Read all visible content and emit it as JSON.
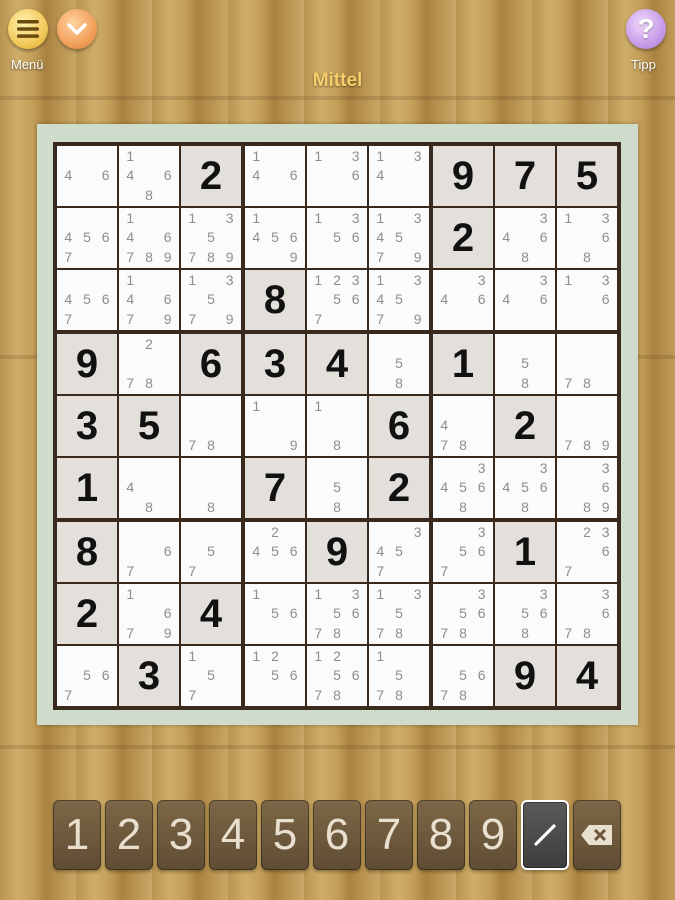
{
  "header": {
    "menu_label": "Menü",
    "tip_label": "Tipp",
    "difficulty": "Mittel",
    "icons": {
      "menu": "hamburger-icon",
      "collapse": "chevron-down-icon",
      "tip": "question-icon"
    }
  },
  "board": {
    "cells": [
      [
        {
          "n": [
            4,
            6
          ]
        },
        {
          "n": [
            1,
            4,
            6,
            8
          ]
        },
        {
          "v": 2
        },
        {
          "n": [
            1,
            4,
            6
          ]
        },
        {
          "n": [
            1,
            3,
            6
          ]
        },
        {
          "n": [
            1,
            3,
            4
          ]
        },
        {
          "v": 9
        },
        {
          "v": 7
        },
        {
          "v": 5
        }
      ],
      [
        {
          "n": [
            4,
            5,
            6,
            7
          ]
        },
        {
          "n": [
            1,
            4,
            6,
            7,
            8,
            9
          ]
        },
        {
          "n": [
            1,
            3,
            5,
            7,
            8,
            9
          ]
        },
        {
          "n": [
            1,
            4,
            5,
            6,
            9
          ]
        },
        {
          "n": [
            1,
            3,
            5,
            6
          ]
        },
        {
          "n": [
            1,
            3,
            4,
            5,
            7,
            9
          ]
        },
        {
          "v": 2
        },
        {
          "n": [
            3,
            4,
            6,
            8
          ]
        },
        {
          "n": [
            1,
            3,
            6,
            8
          ]
        }
      ],
      [
        {
          "n": [
            4,
            5,
            6,
            7
          ]
        },
        {
          "n": [
            1,
            4,
            6,
            7,
            9
          ]
        },
        {
          "n": [
            1,
            3,
            5,
            7,
            9
          ]
        },
        {
          "v": 8
        },
        {
          "n": [
            1,
            2,
            3,
            5,
            6,
            7
          ]
        },
        {
          "n": [
            1,
            3,
            4,
            5,
            7,
            9
          ]
        },
        {
          "n": [
            3,
            4,
            6
          ]
        },
        {
          "n": [
            3,
            4,
            6
          ]
        },
        {
          "n": [
            1,
            3,
            6
          ]
        }
      ],
      [
        {
          "v": 9
        },
        {
          "n": [
            2,
            7,
            8
          ]
        },
        {
          "v": 6
        },
        {
          "v": 3
        },
        {
          "v": 4
        },
        {
          "n": [
            5,
            8
          ]
        },
        {
          "v": 1
        },
        {
          "n": [
            5,
            8
          ]
        },
        {
          "n": [
            7,
            8
          ]
        }
      ],
      [
        {
          "v": 3
        },
        {
          "v": 5
        },
        {
          "n": [
            7,
            8
          ]
        },
        {
          "n": [
            1,
            9
          ]
        },
        {
          "n": [
            1,
            8
          ]
        },
        {
          "v": 6
        },
        {
          "n": [
            4,
            7,
            8
          ]
        },
        {
          "v": 2
        },
        {
          "n": [
            7,
            8,
            9
          ]
        }
      ],
      [
        {
          "v": 1
        },
        {
          "n": [
            4,
            8
          ]
        },
        {
          "n": [
            8
          ]
        },
        {
          "v": 7
        },
        {
          "n": [
            5,
            8
          ]
        },
        {
          "v": 2
        },
        {
          "n": [
            3,
            4,
            5,
            6,
            8
          ]
        },
        {
          "n": [
            3,
            4,
            5,
            6,
            8
          ]
        },
        {
          "n": [
            3,
            6,
            8,
            9
          ]
        }
      ],
      [
        {
          "v": 8
        },
        {
          "n": [
            6,
            7
          ]
        },
        {
          "n": [
            5,
            7
          ]
        },
        {
          "n": [
            2,
            4,
            5,
            6
          ]
        },
        {
          "v": 9
        },
        {
          "n": [
            3,
            4,
            5,
            7
          ]
        },
        {
          "n": [
            3,
            5,
            6,
            7
          ]
        },
        {
          "v": 1
        },
        {
          "n": [
            2,
            3,
            6,
            7
          ]
        }
      ],
      [
        {
          "v": 2
        },
        {
          "n": [
            1,
            6,
            7,
            9
          ]
        },
        {
          "v": 4
        },
        {
          "n": [
            1,
            5,
            6
          ]
        },
        {
          "n": [
            1,
            3,
            5,
            6,
            7,
            8
          ]
        },
        {
          "n": [
            1,
            3,
            5,
            7,
            8
          ]
        },
        {
          "n": [
            3,
            5,
            6,
            7,
            8
          ]
        },
        {
          "n": [
            3,
            5,
            6,
            8
          ]
        },
        {
          "n": [
            3,
            6,
            7,
            8
          ]
        }
      ],
      [
        {
          "n": [
            5,
            6,
            7
          ]
        },
        {
          "v": 3
        },
        {
          "n": [
            1,
            5,
            7
          ]
        },
        {
          "n": [
            1,
            2,
            5,
            6
          ]
        },
        {
          "n": [
            1,
            2,
            5,
            6,
            7,
            8
          ]
        },
        {
          "n": [
            1,
            5,
            7,
            8
          ]
        },
        {
          "n": [
            5,
            6,
            7,
            8
          ]
        },
        {
          "v": 9
        },
        {
          "v": 4
        }
      ]
    ]
  },
  "keypad": {
    "digits": [
      "1",
      "2",
      "3",
      "4",
      "5",
      "6",
      "7",
      "8",
      "9"
    ],
    "pen_icon": "pencil-icon",
    "erase_icon": "backspace-icon"
  }
}
